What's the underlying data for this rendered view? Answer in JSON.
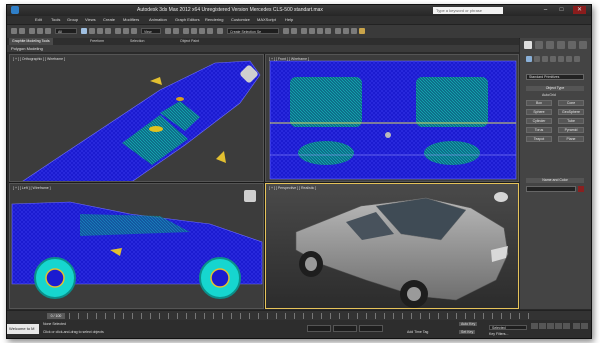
{
  "window": {
    "title": "Autodesk 3ds Max  2012 x64      Unregistered Version    Mercedes CLS-500 standart.max",
    "search_placeholder": "Type a keyword or phrase",
    "minimize": "–",
    "maximize": "□",
    "close": "✕"
  },
  "menu": {
    "items": [
      "Edit",
      "Tools",
      "Group",
      "Views",
      "Create",
      "Modifiers",
      "Animation",
      "Graph Editors",
      "Rendering",
      "Customize",
      "MAXScript",
      "Help"
    ]
  },
  "toolbar": {
    "selection_filter": "All",
    "named_selection": "View",
    "named_set": "Create Selection Se"
  },
  "ribbon": {
    "tabs": [
      "Graphite Modeling Tools",
      "Freeform",
      "Selection",
      "Object Paint"
    ],
    "panel_label": "Polygon Modeling"
  },
  "viewports": {
    "top_left_label": "[ + ] [ Orthographic ] [ Wireframe ]",
    "top_right_label": "[ + ] [ Front ] [ Wireframe ]",
    "bottom_left_label": "[ + ] [ Left ] [ Wireframe ]",
    "bottom_right_label": "[ + ] [ Perspective ] [ Realistic ]"
  },
  "command_panel": {
    "category_dropdown": "Standard Primitives",
    "object_type_label": "Object Type",
    "autogrid": "AutoGrid",
    "primitives": [
      "Box",
      "Cone",
      "Sphere",
      "GeoSphere",
      "Cylinder",
      "Tube",
      "Torus",
      "Pyramid",
      "Teapot",
      "Plane"
    ],
    "name_color_label": "Name and Color"
  },
  "timeline": {
    "frame_indicator": "0 / 100"
  },
  "status": {
    "maxscript_label": "Welcome to M",
    "selection_info": "None Selected",
    "prompt": "Click or click-and-drag to select objects",
    "add_time_tag": "Add Time Tag",
    "auto_key": "Auto Key",
    "set_key": "Set Key",
    "key_filter": "Selected",
    "key_filters_label": "Key Filters..."
  },
  "colors": {
    "wire_blue": "#1b1bd0",
    "wire_cyan": "#16d6cf",
    "active_border": "#e6c35a",
    "render_swatch": "#8a2020"
  }
}
